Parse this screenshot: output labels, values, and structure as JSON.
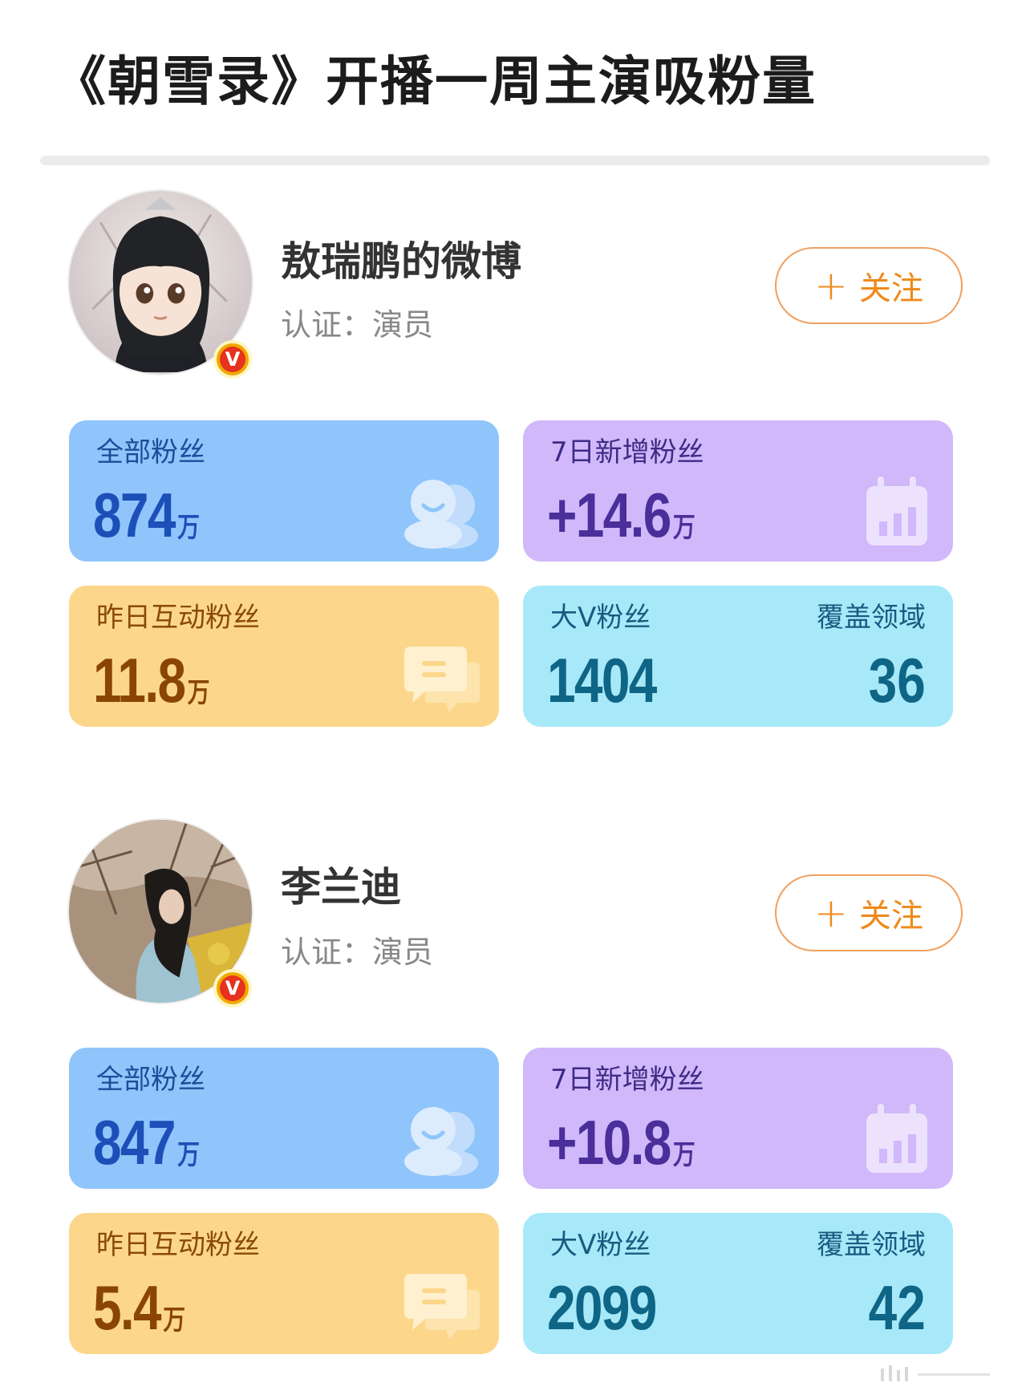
{
  "page": {
    "title": "《朝雪录》开播一周主演吸粉量"
  },
  "profiles": [
    {
      "name": "敖瑞鹏的微博",
      "verification": "认证：演员",
      "follow_label": "关注",
      "verified_badge": "V",
      "stats": {
        "total_fans": {
          "label": "全部粉丝",
          "value": "874",
          "unit": "万"
        },
        "new_fans_7d": {
          "label": "7日新增粉丝",
          "value": "+14.6",
          "unit": "万"
        },
        "interactive_fans_yesterday": {
          "label": "昨日互动粉丝",
          "value": "11.8",
          "unit": "万"
        },
        "bigv_fans": {
          "label": "大V粉丝",
          "value": "1404"
        },
        "coverage_fields": {
          "label": "覆盖领域",
          "value": "36"
        }
      }
    },
    {
      "name": "李兰迪",
      "verification": "认证：演员",
      "follow_label": "关注",
      "verified_badge": "V",
      "stats": {
        "total_fans": {
          "label": "全部粉丝",
          "value": "847",
          "unit": "万"
        },
        "new_fans_7d": {
          "label": "7日新增粉丝",
          "value": "+10.8",
          "unit": "万"
        },
        "interactive_fans_yesterday": {
          "label": "昨日互动粉丝",
          "value": "5.4",
          "unit": "万"
        },
        "bigv_fans": {
          "label": "大V粉丝",
          "value": "2099"
        },
        "coverage_fields": {
          "label": "覆盖领域",
          "value": "42"
        }
      }
    }
  ],
  "icons": {
    "follow": "plus-icon",
    "total_fans": "people-icon",
    "new_fans": "calendar-chart-icon",
    "interactive": "chat-bubble-icon",
    "badge": "verified-v-icon"
  },
  "colors": {
    "blue_card": "#8fc5fb",
    "purple_card": "#d1b8fa",
    "yellow_card": "#fcd78b",
    "cyan_card": "#a7e9f9",
    "follow_accent": "#ee8a1a",
    "badge_red": "#e6321e"
  }
}
